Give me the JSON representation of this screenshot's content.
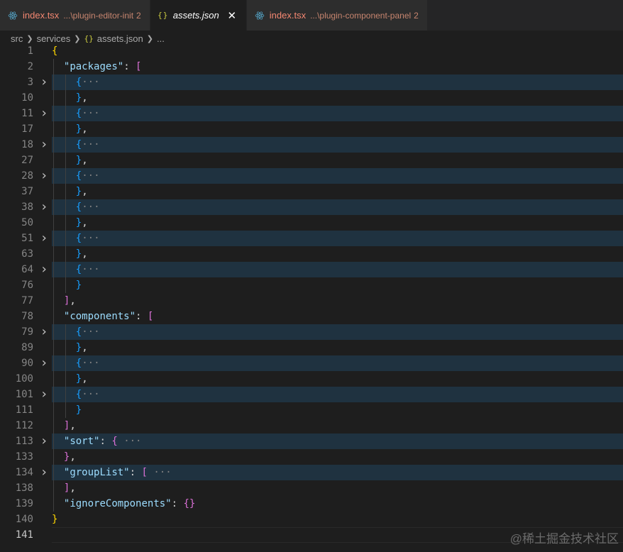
{
  "tabs": [
    {
      "name": "index.tsx",
      "path": "...\\plugin-editor-init",
      "badge": "2",
      "icon": "react-icon",
      "active": false
    },
    {
      "name": "assets.json",
      "path": "",
      "badge": "",
      "icon": "json-icon",
      "active": true
    },
    {
      "name": "index.tsx",
      "path": "...\\plugin-component-panel",
      "badge": "2",
      "icon": "react-icon",
      "active": false
    }
  ],
  "tab_close_glyph": "✕",
  "json_icon_glyph": "{}",
  "breadcrumb": {
    "items": [
      "src",
      "services",
      "assets.json",
      "..."
    ]
  },
  "lines": [
    {
      "n": "1",
      "fold": false,
      "hl": false,
      "indent": 0,
      "parts": [
        [
          "b1",
          "{"
        ]
      ]
    },
    {
      "n": "2",
      "fold": false,
      "hl": false,
      "indent": 1,
      "parts": [
        [
          "key",
          "\"packages\""
        ],
        [
          "p",
          ": "
        ],
        [
          "b2",
          "["
        ]
      ]
    },
    {
      "n": "3",
      "fold": true,
      "hl": true,
      "indent": 2,
      "parts": [
        [
          "b3",
          "{"
        ],
        [
          "ell",
          "···"
        ]
      ]
    },
    {
      "n": "10",
      "fold": false,
      "hl": false,
      "indent": 2,
      "parts": [
        [
          "b3",
          "}"
        ],
        [
          "p",
          ","
        ]
      ]
    },
    {
      "n": "11",
      "fold": true,
      "hl": true,
      "indent": 2,
      "parts": [
        [
          "b3",
          "{"
        ],
        [
          "ell",
          "···"
        ]
      ]
    },
    {
      "n": "17",
      "fold": false,
      "hl": false,
      "indent": 2,
      "parts": [
        [
          "b3",
          "}"
        ],
        [
          "p",
          ","
        ]
      ]
    },
    {
      "n": "18",
      "fold": true,
      "hl": true,
      "indent": 2,
      "parts": [
        [
          "b3",
          "{"
        ],
        [
          "ell",
          "···"
        ]
      ]
    },
    {
      "n": "27",
      "fold": false,
      "hl": false,
      "indent": 2,
      "parts": [
        [
          "b3",
          "}"
        ],
        [
          "p",
          ","
        ]
      ]
    },
    {
      "n": "28",
      "fold": true,
      "hl": true,
      "indent": 2,
      "parts": [
        [
          "b3",
          "{"
        ],
        [
          "ell",
          "···"
        ]
      ]
    },
    {
      "n": "37",
      "fold": false,
      "hl": false,
      "indent": 2,
      "parts": [
        [
          "b3",
          "}"
        ],
        [
          "p",
          ","
        ]
      ]
    },
    {
      "n": "38",
      "fold": true,
      "hl": true,
      "indent": 2,
      "parts": [
        [
          "b3",
          "{"
        ],
        [
          "ell",
          "···"
        ]
      ]
    },
    {
      "n": "50",
      "fold": false,
      "hl": false,
      "indent": 2,
      "parts": [
        [
          "b3",
          "}"
        ],
        [
          "p",
          ","
        ]
      ]
    },
    {
      "n": "51",
      "fold": true,
      "hl": true,
      "indent": 2,
      "parts": [
        [
          "b3",
          "{"
        ],
        [
          "ell",
          "···"
        ]
      ]
    },
    {
      "n": "63",
      "fold": false,
      "hl": false,
      "indent": 2,
      "parts": [
        [
          "b3",
          "}"
        ],
        [
          "p",
          ","
        ]
      ]
    },
    {
      "n": "64",
      "fold": true,
      "hl": true,
      "indent": 2,
      "parts": [
        [
          "b3",
          "{"
        ],
        [
          "ell",
          "···"
        ]
      ]
    },
    {
      "n": "76",
      "fold": false,
      "hl": false,
      "indent": 2,
      "parts": [
        [
          "b3",
          "}"
        ]
      ]
    },
    {
      "n": "77",
      "fold": false,
      "hl": false,
      "indent": 1,
      "parts": [
        [
          "b2",
          "]"
        ],
        [
          "p",
          ","
        ]
      ]
    },
    {
      "n": "78",
      "fold": false,
      "hl": false,
      "indent": 1,
      "parts": [
        [
          "key",
          "\"components\""
        ],
        [
          "p",
          ": "
        ],
        [
          "b2",
          "["
        ]
      ]
    },
    {
      "n": "79",
      "fold": true,
      "hl": true,
      "indent": 2,
      "parts": [
        [
          "b3",
          "{"
        ],
        [
          "ell",
          "···"
        ]
      ]
    },
    {
      "n": "89",
      "fold": false,
      "hl": false,
      "indent": 2,
      "parts": [
        [
          "b3",
          "}"
        ],
        [
          "p",
          ","
        ]
      ]
    },
    {
      "n": "90",
      "fold": true,
      "hl": true,
      "indent": 2,
      "parts": [
        [
          "b3",
          "{"
        ],
        [
          "ell",
          "···"
        ]
      ]
    },
    {
      "n": "100",
      "fold": false,
      "hl": false,
      "indent": 2,
      "parts": [
        [
          "b3",
          "}"
        ],
        [
          "p",
          ","
        ]
      ]
    },
    {
      "n": "101",
      "fold": true,
      "hl": true,
      "indent": 2,
      "parts": [
        [
          "b3",
          "{"
        ],
        [
          "ell",
          "···"
        ]
      ]
    },
    {
      "n": "111",
      "fold": false,
      "hl": false,
      "indent": 2,
      "parts": [
        [
          "b3",
          "}"
        ]
      ]
    },
    {
      "n": "112",
      "fold": false,
      "hl": false,
      "indent": 1,
      "parts": [
        [
          "b2",
          "]"
        ],
        [
          "p",
          ","
        ]
      ]
    },
    {
      "n": "113",
      "fold": true,
      "hl": true,
      "indent": 1,
      "parts": [
        [
          "key",
          "\"sort\""
        ],
        [
          "p",
          ": "
        ],
        [
          "b2",
          "{"
        ],
        [
          "ell",
          " ···"
        ]
      ]
    },
    {
      "n": "133",
      "fold": false,
      "hl": false,
      "indent": 1,
      "parts": [
        [
          "b2",
          "}"
        ],
        [
          "p",
          ","
        ]
      ]
    },
    {
      "n": "134",
      "fold": true,
      "hl": true,
      "indent": 1,
      "parts": [
        [
          "key",
          "\"groupList\""
        ],
        [
          "p",
          ": "
        ],
        [
          "b2",
          "["
        ],
        [
          "ell",
          " ···"
        ]
      ]
    },
    {
      "n": "138",
      "fold": false,
      "hl": false,
      "indent": 1,
      "parts": [
        [
          "b2",
          "]"
        ],
        [
          "p",
          ","
        ]
      ]
    },
    {
      "n": "139",
      "fold": false,
      "hl": false,
      "indent": 1,
      "parts": [
        [
          "key",
          "\"ignoreComponents\""
        ],
        [
          "p",
          ": "
        ],
        [
          "b2",
          "{}"
        ]
      ]
    },
    {
      "n": "140",
      "fold": false,
      "hl": false,
      "indent": 0,
      "parts": [
        [
          "b1",
          "}"
        ]
      ]
    },
    {
      "n": "141",
      "fold": false,
      "hl": false,
      "indent": 0,
      "cur": true,
      "parts": []
    }
  ],
  "watermark": "@稀土掘金技术社区",
  "colors": {
    "background": "#1e1e1e",
    "highlight": "#1f3240",
    "bracket1": "#ffd700",
    "bracket2": "#da70d6",
    "bracket3": "#179fff",
    "key": "#9cdcfe"
  }
}
